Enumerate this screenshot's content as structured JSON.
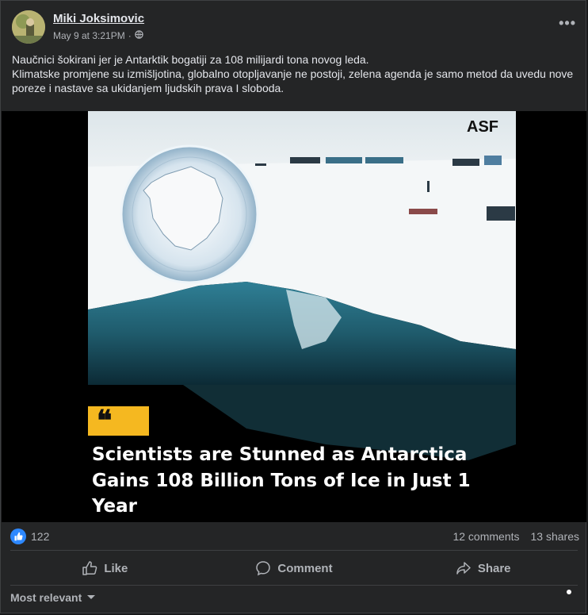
{
  "post": {
    "author": "Miki Joksimovic",
    "timestamp": "May 9 at 3:21PM",
    "separator": "·",
    "privacy_icon": "globe-icon",
    "more_label": "•••",
    "text_line1": "Naučnici šokirani jer je Antarktik bogatiji za 108 milijardi tona novog leda.",
    "text_line2": "Klimatske promjene su izmišljotina, globalno otopljavanje ne postoji, zelena agenda je samo metod da uvedu nove poreze i nastave sa ukidanjem ljudskih prava I sloboda."
  },
  "media": {
    "watermark": "ASF",
    "quote_mark": "❝",
    "headline_line1": "Scientists are Stunned as Antarctica",
    "headline_line2": "Gains 108 Billion Tons of Ice in Just 1",
    "headline_line3": "Year",
    "quote_badge_color": "#f5b820"
  },
  "stats": {
    "reaction_icon": "thumbs-up-icon",
    "reactions": "122",
    "comments": "12 comments",
    "shares": "13 shares"
  },
  "actions": {
    "like": "Like",
    "comment": "Comment",
    "share": "Share"
  },
  "comments": {
    "sort_label": "Most relevant"
  },
  "colors": {
    "accent": "#2d88ff",
    "background": "#242526"
  }
}
